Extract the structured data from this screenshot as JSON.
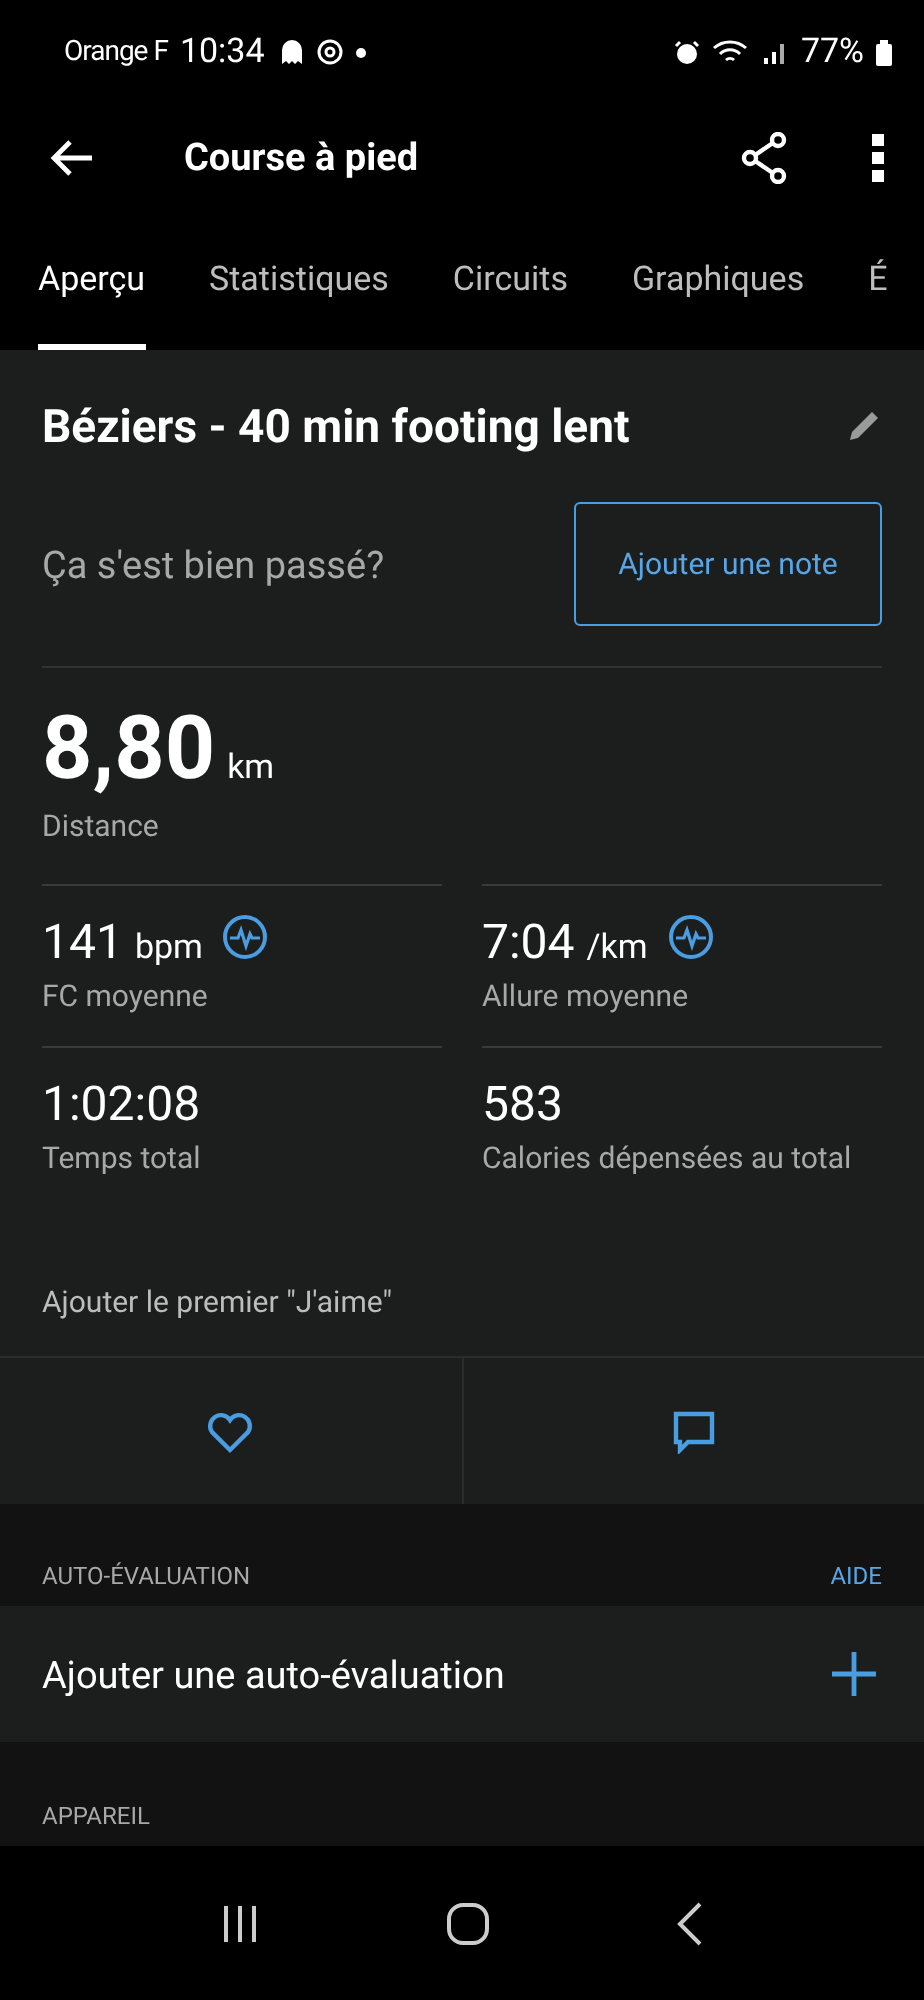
{
  "status_bar": {
    "carrier": "Orange F",
    "time": "10:34",
    "battery": "77%"
  },
  "app_bar": {
    "title": "Course à pied"
  },
  "tabs": [
    {
      "label": "Aperçu",
      "selected": true
    },
    {
      "label": "Statistiques",
      "selected": false
    },
    {
      "label": "Circuits",
      "selected": false
    },
    {
      "label": "Graphiques",
      "selected": false
    },
    {
      "label": "É",
      "selected": false
    }
  ],
  "activity": {
    "title": "Béziers - 40 min footing lent",
    "note_prompt": "Ça s'est bien passé?",
    "note_button": "Ajouter une note"
  },
  "distance": {
    "value": "8,80",
    "unit": "km",
    "label": "Distance"
  },
  "stats": [
    {
      "value": "141",
      "unit": "bpm",
      "label": "FC moyenne",
      "chart_link": true
    },
    {
      "value": "7:04",
      "unit": "/km",
      "label": "Allure moyenne",
      "chart_link": true
    },
    {
      "value": "1:02:08",
      "label": "Temps total",
      "chart_link": false
    },
    {
      "value": "583",
      "label": "Calories dépensées au total",
      "chart_link": false
    }
  ],
  "likes_text": "Ajouter le premier \"J'aime\"",
  "self_evaluation": {
    "header": "AUTO-ÉVALUATION",
    "help": "AIDE",
    "add_label": "Ajouter une auto-évaluation"
  },
  "device": {
    "header": "APPAREIL"
  }
}
